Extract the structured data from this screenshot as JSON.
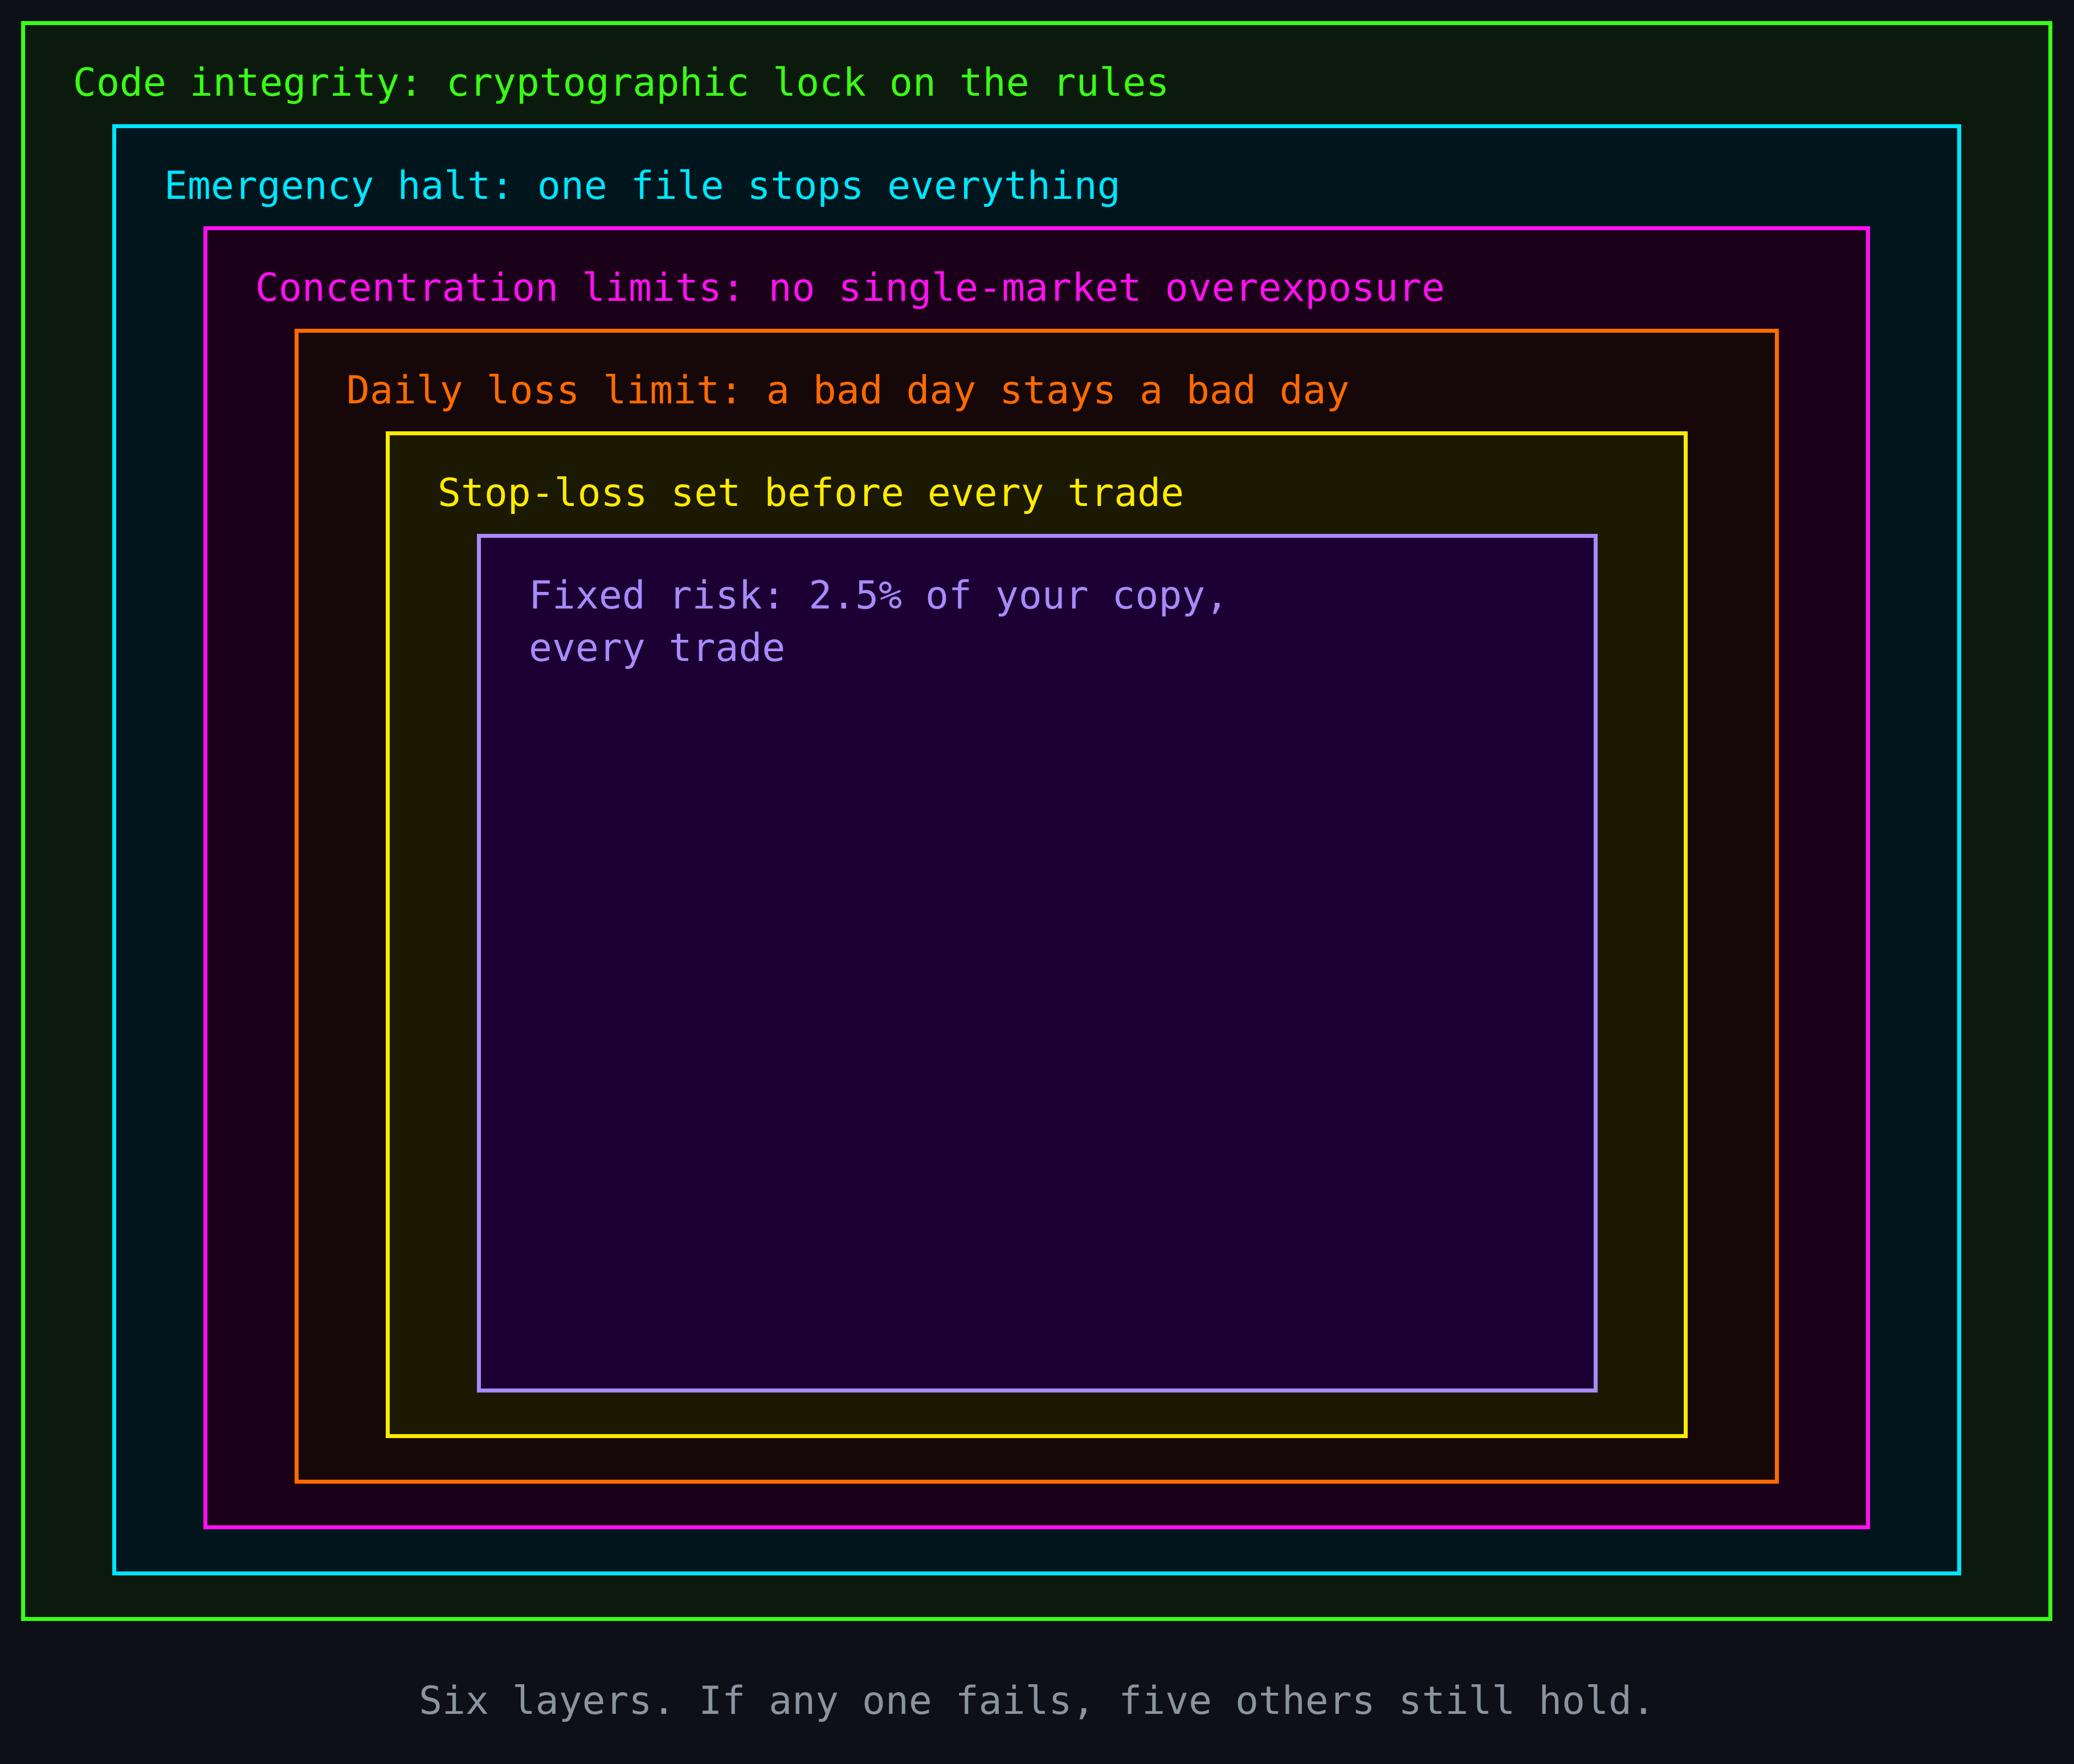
{
  "layers": [
    {
      "label": "Code integrity: cryptographic lock on the rules",
      "color": "#39ff14"
    },
    {
      "label": "Emergency halt: one file stops everything",
      "color": "#00e5ff"
    },
    {
      "label": "Concentration limits: no single-market overexposure",
      "color": "#ff10f0"
    },
    {
      "label": "Daily loss limit: a bad day stays a bad day",
      "color": "#ff6a00"
    },
    {
      "label": "Stop-loss set before every trade",
      "color": "#ffeb00"
    },
    {
      "label": "Fixed risk: 2.5% of your copy,\nevery trade",
      "color": "#a78bfa"
    }
  ],
  "caption": "Six layers. If any one fails, five others still hold."
}
